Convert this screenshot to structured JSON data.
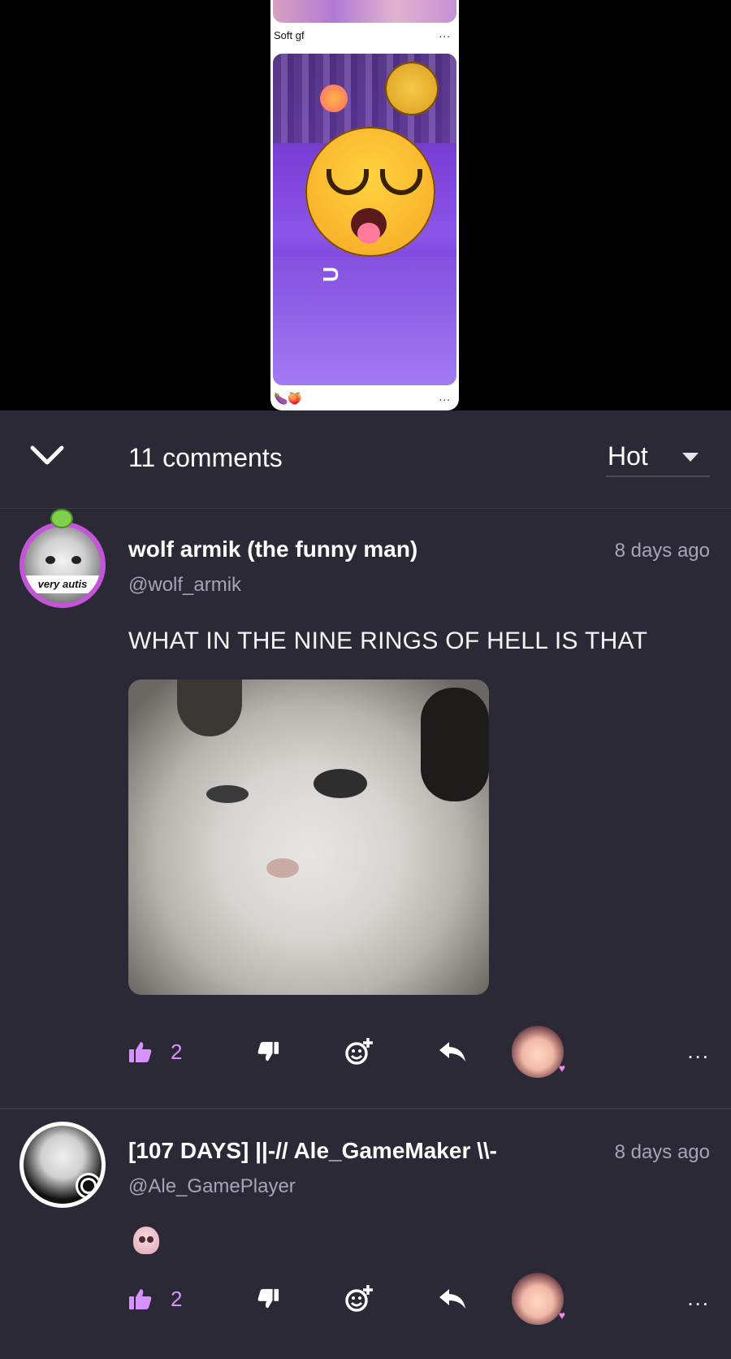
{
  "media": {
    "caption": "Soft gf",
    "dots": "...",
    "bottom_dots": "..."
  },
  "header": {
    "comments_count": "11 comments",
    "sort_selected": "Hot"
  },
  "comments": [
    {
      "name": "wolf armik (the funny man)",
      "handle": "@wolf_armik",
      "time": "8 days ago",
      "text": "WHAT IN THE NINE RINGS OF HELL IS THAT",
      "avatar_banner": "very autis",
      "likes": "2",
      "more": "..."
    },
    {
      "name": "[107 DAYS] ||-// Ale_GameMaker \\\\-",
      "handle": "@Ale_GamePlayer",
      "time": "8 days ago",
      "likes": "2",
      "more": "..."
    }
  ],
  "colors": {
    "background": "#2b2935",
    "accent": "#d892ff",
    "muted_text": "#a7a5b3"
  },
  "icons": {
    "collapse": "chevron-down-icon",
    "sort": "caret-down-icon",
    "like": "thumbs-up-icon",
    "dislike": "thumbs-down-icon",
    "react": "add-reaction-icon",
    "reply": "reply-icon"
  }
}
